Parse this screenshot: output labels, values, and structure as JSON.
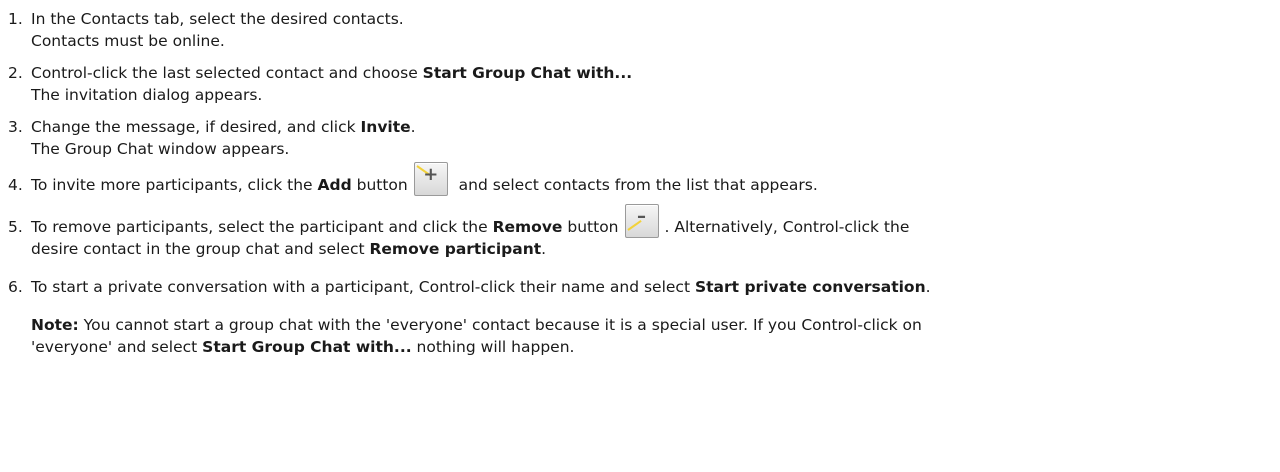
{
  "steps": [
    {
      "num": "1.",
      "line1": "In the Contacts tab, select the desired contacts.",
      "line2": "Contacts must be online."
    },
    {
      "num": "2.",
      "line1_pre": "Control-click the last selected contact and choose ",
      "line1_bold": "Start Group Chat with...",
      "line2": "The invitation dialog appears."
    },
    {
      "num": "3.",
      "line1_pre": "Change the message, if desired, and click ",
      "line1_bold": "Invite",
      "line1_post": ".",
      "line2": "The Group Chat window appears."
    },
    {
      "num": "4.",
      "pre": "To invite more participants, click the ",
      "bold": "Add",
      "mid": " button",
      "post": " and select contacts from the list that appears.",
      "icon": "add-button-icon",
      "icon_glyph": "+"
    },
    {
      "num": "5.",
      "pre": "To remove participants, select the participant and click the ",
      "bold": "Remove",
      "mid": " button",
      "post": ".  Alternatively, Control-click the",
      "line2_pre": "desire contact in the group chat and select ",
      "line2_bold": "Remove participant",
      "line2_post": ".",
      "icon": "remove-button-icon",
      "icon_glyph": "–"
    },
    {
      "num": "6.",
      "pre": "To start a private conversation with a participant, Control-click their name and select ",
      "bold": "Start private conversation",
      "post": "."
    }
  ],
  "note": {
    "label": "Note:",
    "line1": " You cannot start a group chat with the 'everyone' contact because it is a special user.  If you Control-click on",
    "line2_pre": "'everyone' and select ",
    "line2_bold": "Start Group Chat with...",
    "line2_post": " nothing will happen."
  },
  "colors": {
    "text": "#1a1a1a",
    "button_border": "#9a9a9a",
    "button_streak": "#f2d23a"
  }
}
